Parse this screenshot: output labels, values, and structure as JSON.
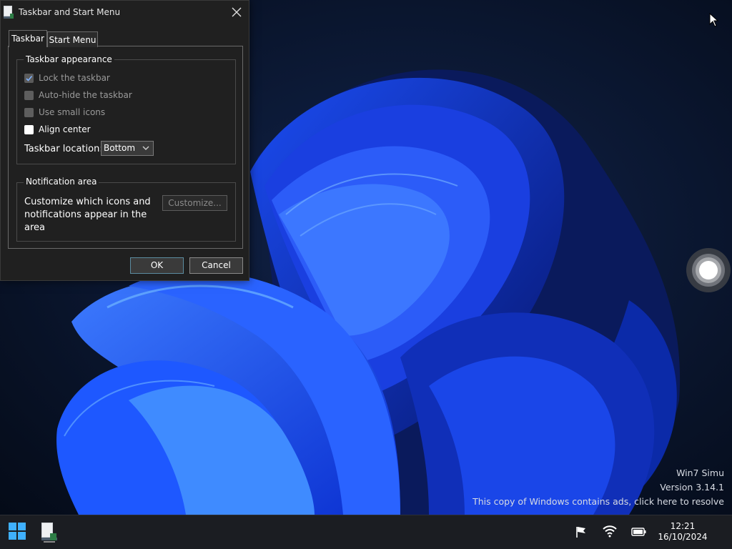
{
  "dialog": {
    "title": "Taskbar and Start Menu",
    "tabs": [
      "Taskbar",
      "Start Menu"
    ],
    "appearance": {
      "legend": "Taskbar appearance",
      "options": [
        {
          "label": "Lock the taskbar",
          "checked": true,
          "enabled": false
        },
        {
          "label": "Auto-hide the taskbar",
          "checked": false,
          "enabled": false
        },
        {
          "label": "Use small icons",
          "checked": false,
          "enabled": false
        },
        {
          "label": "Align center",
          "checked": false,
          "enabled": true
        }
      ],
      "location_label": "Taskbar location:",
      "location_value": "Bottom"
    },
    "notification": {
      "legend": "Notification area",
      "description": "Customize which icons and notifications appear in the area",
      "customize_label": "Customize..."
    },
    "ok_label": "OK",
    "cancel_label": "Cancel"
  },
  "watermark": {
    "product": "Win7 Simu",
    "version": "Version 3.14.1",
    "notice": "This copy of Windows contains ads, click here to resolve"
  },
  "taskbar": {
    "start_icon": "windows-logo-icon",
    "pinned": [
      "taskbar-settings-app-icon"
    ],
    "tray_icons": [
      "flag-icon",
      "wifi-icon",
      "battery-icon"
    ],
    "time": "12:21",
    "date": "16/10/2024"
  },
  "colors": {
    "accent": "#0078d4",
    "dialog_bg": "#202020",
    "taskbar_bg": "#1b1d22"
  }
}
